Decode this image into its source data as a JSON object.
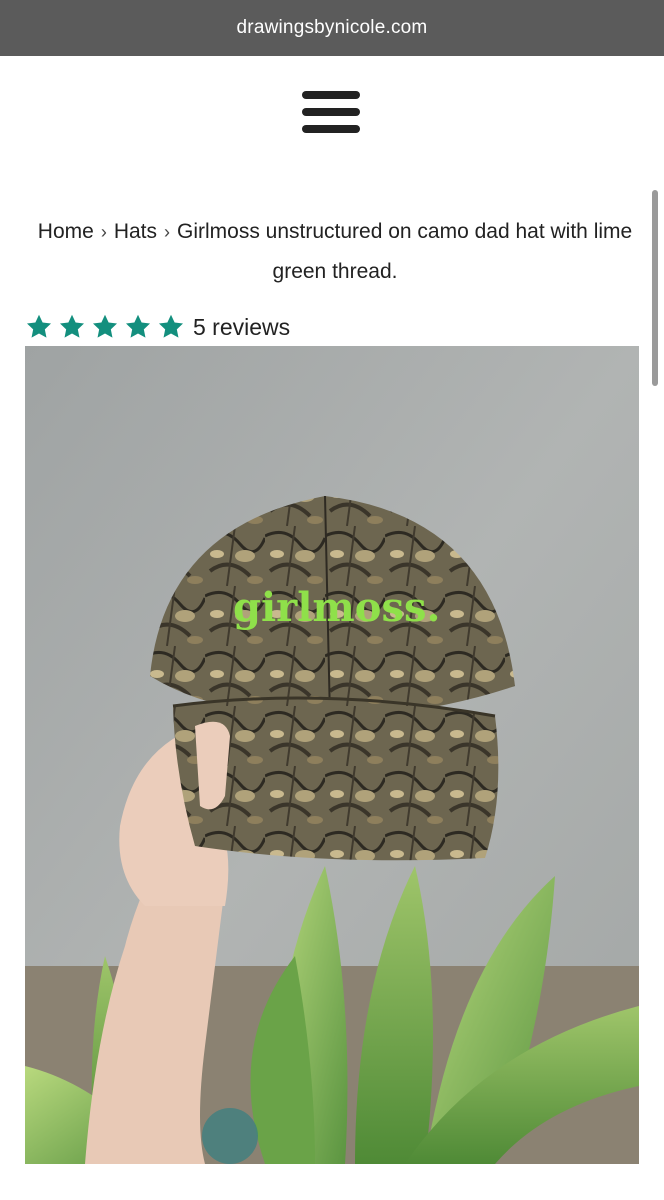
{
  "browser": {
    "url": "drawingsbynicole.com"
  },
  "header": {
    "menu_icon": "hamburger-menu-icon"
  },
  "breadcrumb": {
    "items": [
      "Home",
      "Hats",
      "Girlmoss unstructured on camo dad hat with lime green thread."
    ],
    "separator": "›"
  },
  "rating": {
    "stars": 5,
    "max_stars": 5,
    "reviews_label": "5 reviews",
    "star_color": "#138f7e"
  },
  "product_image": {
    "embroidery_text": "girlmoss.",
    "embroidery_color": "#8fe04a"
  }
}
